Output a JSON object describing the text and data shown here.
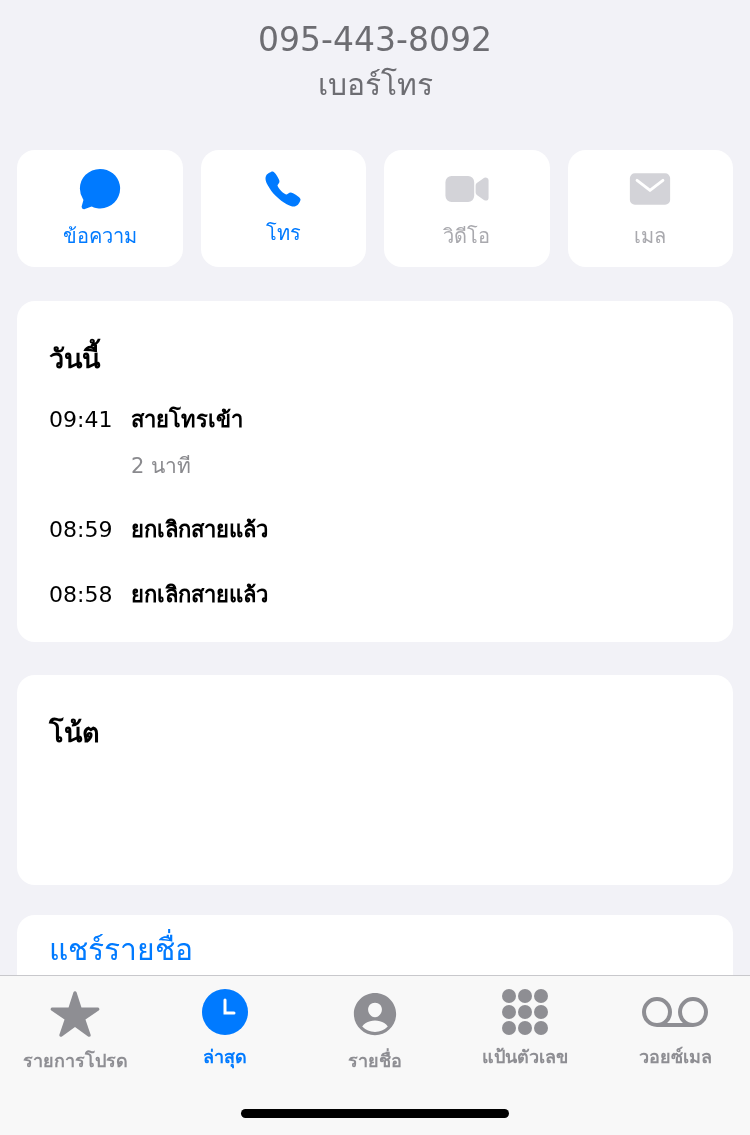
{
  "header": {
    "number": "095-443-8092",
    "label": "เบอร์โทร"
  },
  "actions": [
    {
      "kind": "message",
      "label": "ข้อความ",
      "disabled": false
    },
    {
      "kind": "call",
      "label": "โทร",
      "disabled": false
    },
    {
      "kind": "video",
      "label": "วิดีโอ",
      "disabled": true
    },
    {
      "kind": "mail",
      "label": "เมล",
      "disabled": true
    }
  ],
  "calls": {
    "title": "วันนี้",
    "items": [
      {
        "time": "09:41",
        "label": "สายโทรเข้า",
        "duration": "2 นาที"
      },
      {
        "time": "08:59",
        "label": "ยกเลิกสายแล้ว"
      },
      {
        "time": "08:58",
        "label": "ยกเลิกสายแล้ว"
      }
    ]
  },
  "notes": {
    "title": "โน้ต"
  },
  "share": {
    "label": "แชร์รายชื่อ"
  },
  "tab_bar": [
    {
      "kind": "favorites",
      "label": "รายการโปรด",
      "selected": false
    },
    {
      "kind": "recents",
      "label": "ล่าสุด",
      "selected": true
    },
    {
      "kind": "contacts",
      "label": "รายชื่อ",
      "selected": false
    },
    {
      "kind": "keypad",
      "label": "แป้นตัวเลข",
      "selected": false
    },
    {
      "kind": "voicemail",
      "label": "วอยซ์เมล",
      "selected": false
    }
  ]
}
